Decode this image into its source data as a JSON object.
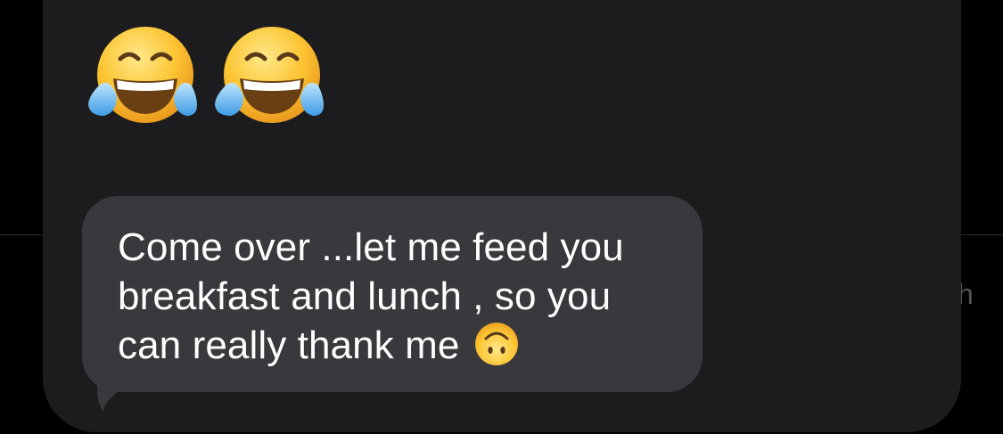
{
  "background": {
    "partial_text": "h"
  },
  "reactions": [
    {
      "icon": "face-with-tears-of-joy-icon"
    },
    {
      "icon": "face-with-tears-of-joy-icon"
    }
  ],
  "message": {
    "lines": [
      "Come over ...let me feed you",
      "breakfast and lunch , so you",
      "can really thank me"
    ],
    "trailing_emoji": "upside-down-face-icon"
  },
  "colors": {
    "screen_background": "#000000",
    "card_background": "#1c1c1e",
    "bubble_background": "#38383d",
    "text": "#ffffff"
  }
}
